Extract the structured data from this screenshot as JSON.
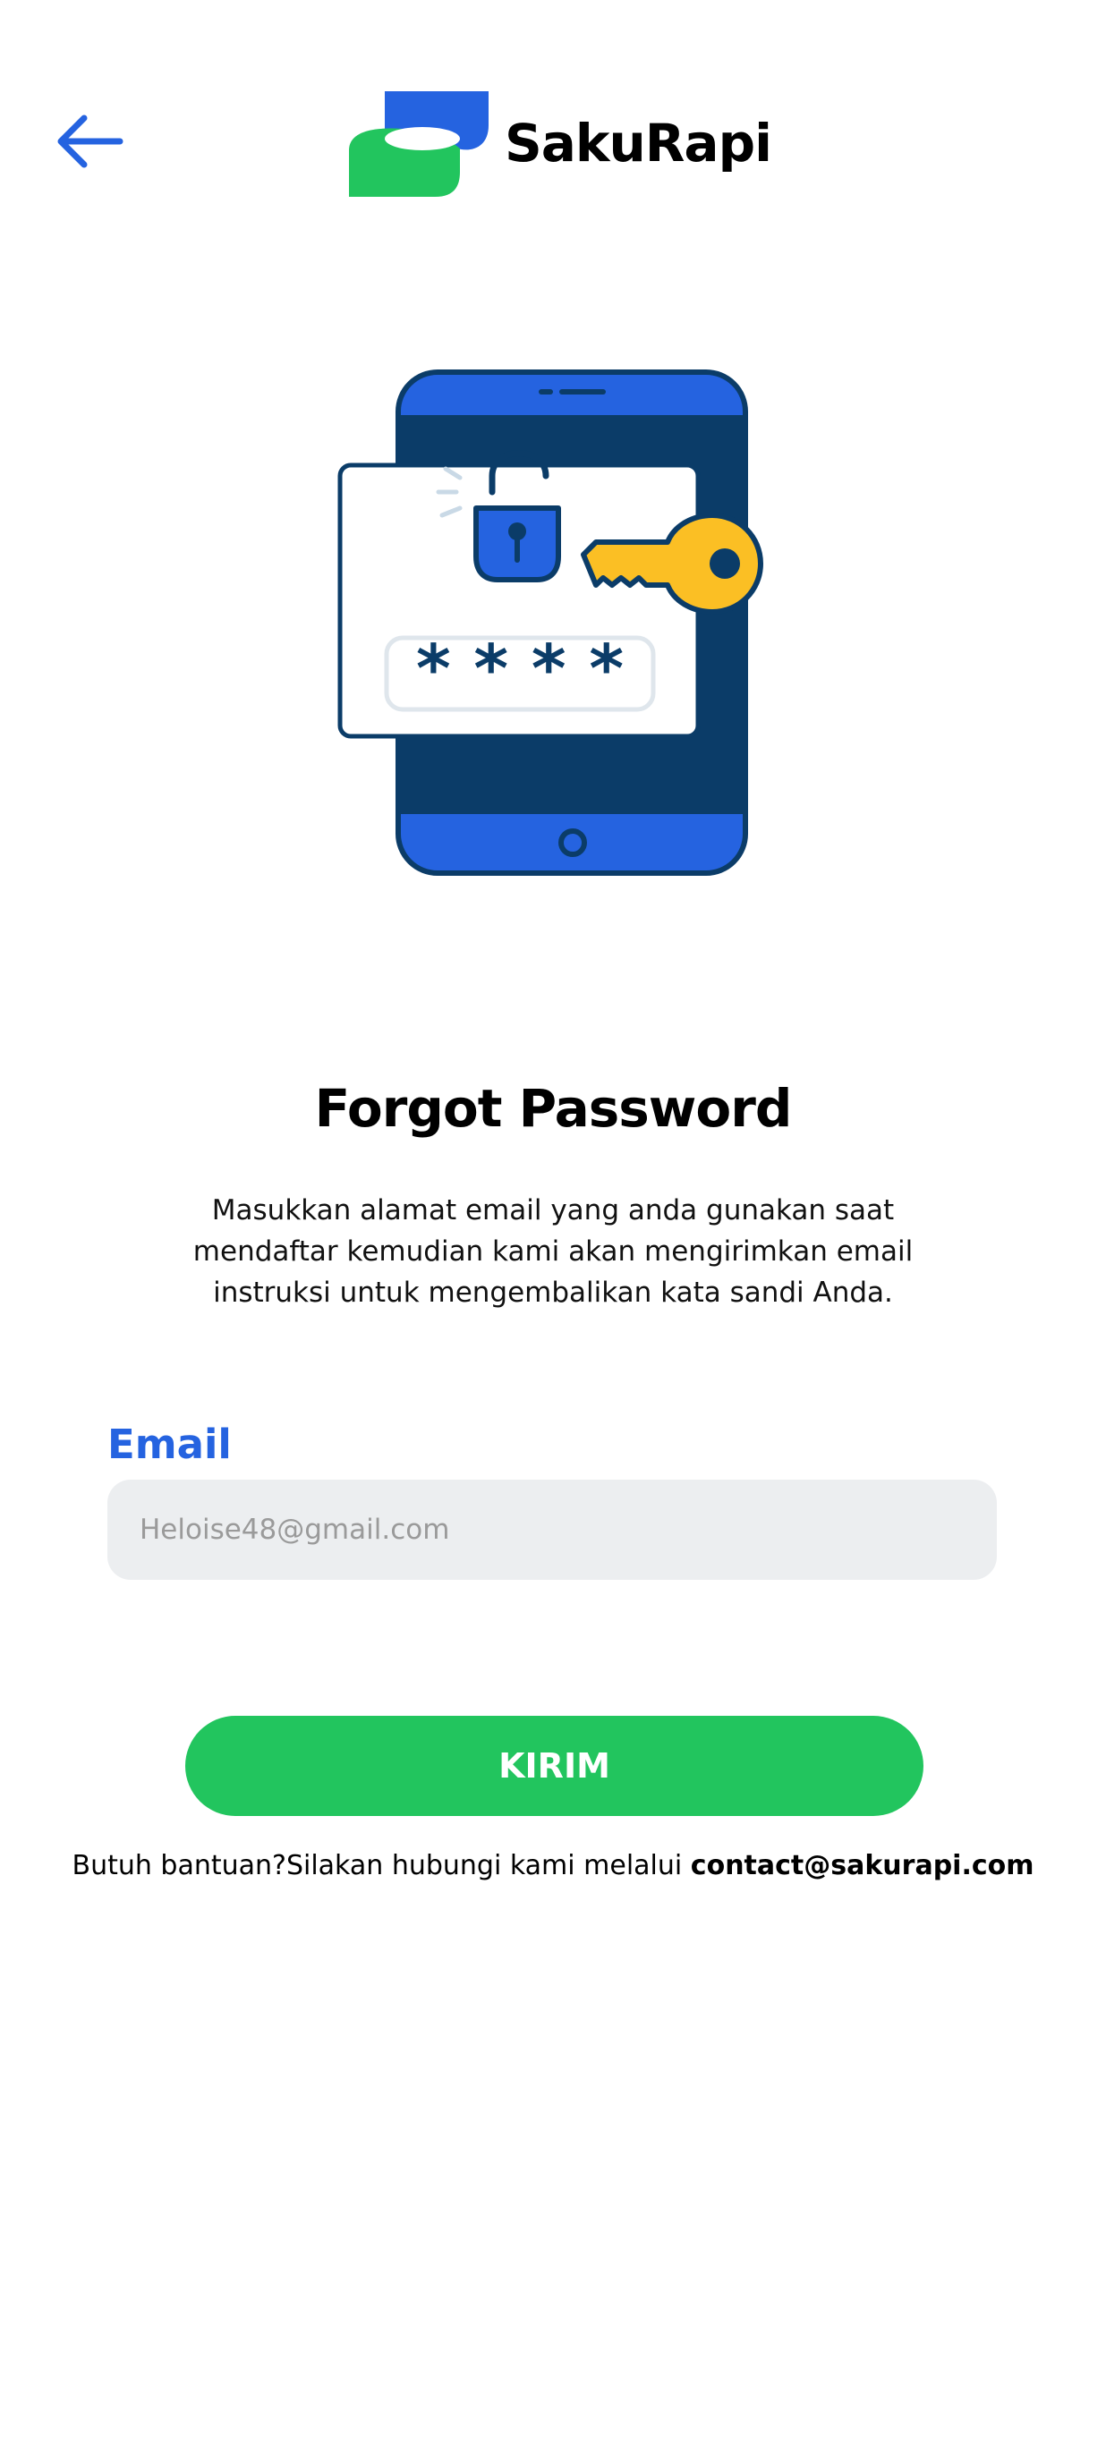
{
  "header": {
    "back_icon": "arrow-left-icon",
    "brand_name": "SakuRapi",
    "brand_colors": {
      "blue": "#2563e0",
      "green": "#22c55e"
    }
  },
  "illustration": {
    "icon": "phone-unlock-key-illustration",
    "password_mask": "* * * *",
    "colors": {
      "phone_blue": "#2563e0",
      "screen_navy": "#0b3c68",
      "key_yellow": "#fbbf24"
    }
  },
  "main": {
    "title": "Forgot Password",
    "description_lines": [
      "Masukkan alamat email yang anda gunakan saat",
      "mendaftar kemudian kami akan mengirimkan email",
      "instruksi untuk mengembalikan kata sandi Anda."
    ]
  },
  "form": {
    "email_label": "Email",
    "email_placeholder": "Heloise48@gmail.com",
    "submit_label": "KIRIM"
  },
  "help": {
    "text": "Butuh bantuan?Silakan hubungi kami melalui",
    "contact": "contact@sakurapi.com"
  }
}
